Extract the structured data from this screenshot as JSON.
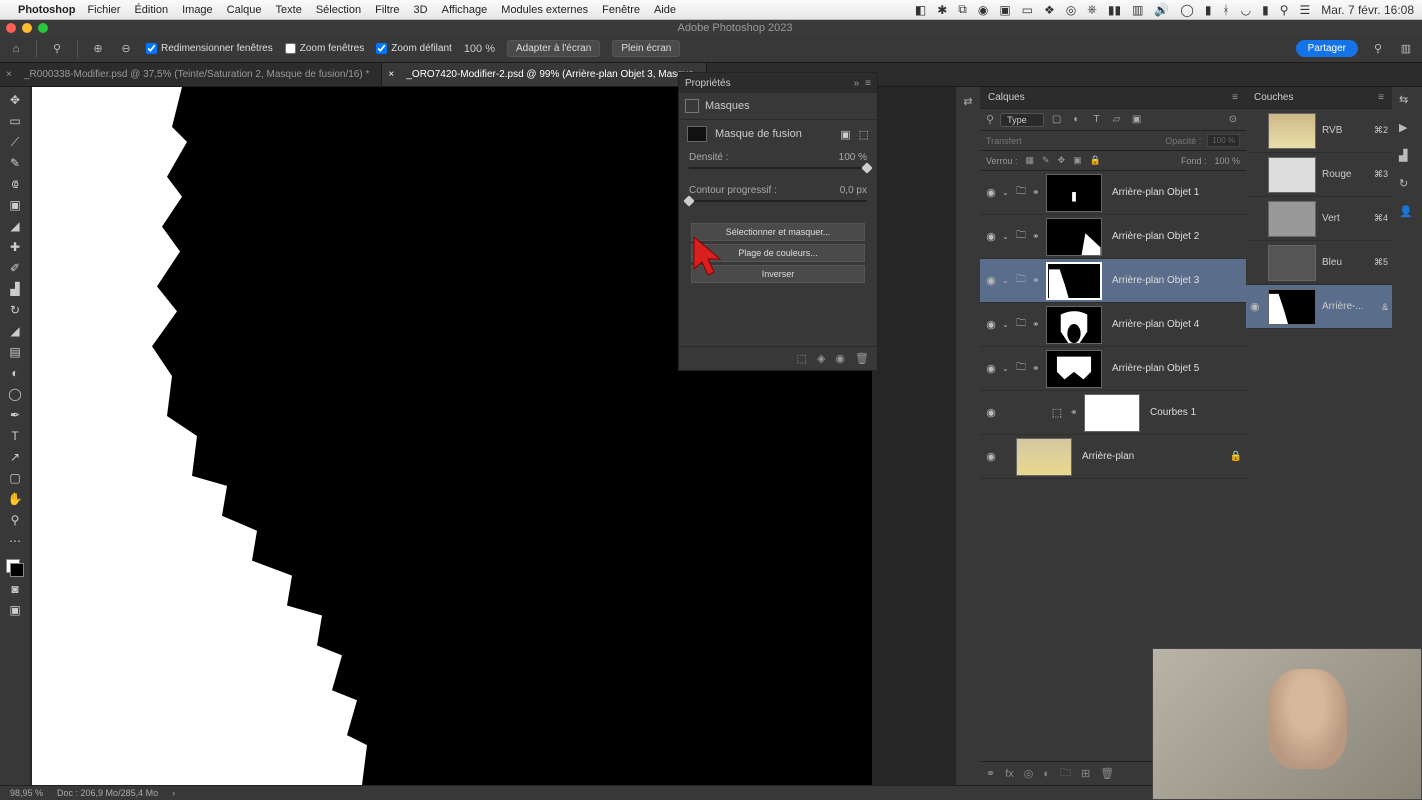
{
  "menubar": {
    "app": "Photoshop",
    "items": [
      "Fichier",
      "Édition",
      "Image",
      "Calque",
      "Texte",
      "Sélection",
      "Filtre",
      "3D",
      "Affichage",
      "Modules externes",
      "Fenêtre",
      "Aide"
    ],
    "clock": "Mar. 7 févr. 16:08"
  },
  "titlebar": "Adobe Photoshop 2023",
  "optbar": {
    "resize": "Redimensionner fenêtres",
    "zoomwin": "Zoom fenêtres",
    "zoomscroll": "Zoom défilant",
    "zoom": "100 %",
    "fit": "Adapter à l'écran",
    "full": "Plein écran",
    "share": "Partager"
  },
  "tabs": [
    "_R000338-Modifier.psd @ 37,5% (Teinte/Saturation 2, Masque de fusion/16) *",
    "_ORO7420-Modifier-2.psd @ 99% (Arrière-plan Objet 3, Masque"
  ],
  "properties": {
    "title": "Propriétés",
    "section": "Masques",
    "mask_label": "Masque de fusion",
    "density_label": "Densité :",
    "density_value": "100 %",
    "feather_label": "Contour progressif :",
    "feather_value": "0,0 px",
    "btn_select": "Sélectionner et masquer...",
    "btn_colorrange": "Plage de couleurs...",
    "btn_invert": "Inverser"
  },
  "layers_panel": {
    "title": "Calques",
    "type_label": "Type",
    "mode_label": "Transfert",
    "opacity_label": "Opacité :",
    "opacity_value": "100 %",
    "fill_label": "Fond :",
    "fill_value": "100 %",
    "lock_label": "Verrou :",
    "layers": [
      {
        "name": "Arrière-plan Objet 1",
        "group": true
      },
      {
        "name": "Arrière-plan Objet 2",
        "group": true
      },
      {
        "name": "Arrière-plan Objet 3",
        "group": true,
        "selected": true
      },
      {
        "name": "Arrière-plan Objet 4",
        "group": true
      },
      {
        "name": "Arrière-plan Objet 5",
        "group": true
      },
      {
        "name": "Courbes 1",
        "adj": true
      },
      {
        "name": "Arrière-plan",
        "bg": true
      }
    ]
  },
  "channels_panel": {
    "title": "Couches",
    "channels": [
      {
        "name": "RVB",
        "shortcut": "⌘2"
      },
      {
        "name": "Rouge",
        "shortcut": "⌘3"
      },
      {
        "name": "Vert",
        "shortcut": "⌘4"
      },
      {
        "name": "Bleu",
        "shortcut": "⌘5"
      },
      {
        "name": "Arrière-...",
        "shortcut": "&",
        "selected": true
      }
    ]
  },
  "status": {
    "zoom": "98,95 %",
    "doc": "Doc : 206,9 Mo/285,4 Mo"
  }
}
